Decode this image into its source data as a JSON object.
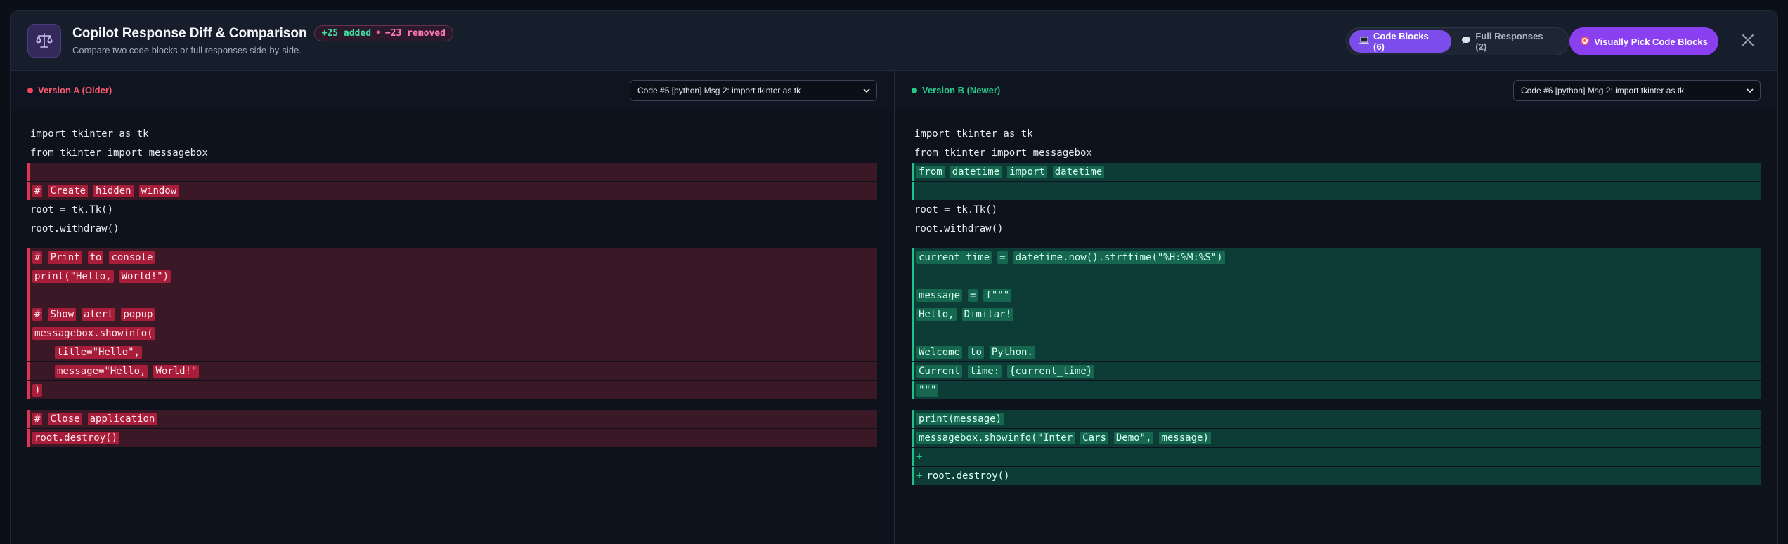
{
  "header": {
    "title": "Copilot Response Diff & Comparison",
    "stats": {
      "added": "+25 added",
      "sep": "•",
      "removed": "−23 removed"
    },
    "subtitle": "Compare two code blocks or full responses side-by-side.",
    "tabs": [
      {
        "label": "Code Blocks (6)",
        "icon": "laptop-icon",
        "active": true
      },
      {
        "label": "Full Responses (2)",
        "icon": "speech-bubble-icon",
        "active": false
      }
    ],
    "pick_button": {
      "label": "Visually Pick Code Blocks",
      "icon": "target-icon"
    },
    "close_icon": "close-icon"
  },
  "colors": {
    "accent": "#7c4dea",
    "removed": "#e0344f",
    "added": "#1fc28a"
  },
  "left": {
    "label": "Version A (Older)",
    "selected": "Code #5 [python] Msg 2: import tkinter as tk",
    "lines": [
      {
        "t": "plain",
        "text": "import tkinter as tk"
      },
      {
        "t": "plain",
        "text": "from tkinter import messagebox"
      },
      {
        "t": "removed",
        "toks": []
      },
      {
        "t": "removed",
        "toks": [
          "#",
          "Create",
          "hidden",
          "window"
        ]
      },
      {
        "t": "plain",
        "text": "root = tk.Tk()"
      },
      {
        "t": "plain",
        "text": "root.withdraw()"
      },
      {
        "t": "gap"
      },
      {
        "t": "removed",
        "toks": [
          "#",
          "Print",
          "to",
          "console"
        ]
      },
      {
        "t": "removed",
        "toks": [
          "print(\"Hello,",
          "World!\")"
        ]
      },
      {
        "t": "removed",
        "toks": []
      },
      {
        "t": "removed",
        "toks": [
          "#",
          "Show",
          "alert",
          "popup"
        ]
      },
      {
        "t": "removed",
        "toks": [
          "messagebox.showinfo("
        ]
      },
      {
        "t": "removed",
        "indent": true,
        "toks": [
          "title=\"Hello\","
        ]
      },
      {
        "t": "removed",
        "indent": true,
        "toks": [
          "message=\"Hello,",
          "World!\""
        ]
      },
      {
        "t": "removed",
        "toks": [
          ")"
        ]
      },
      {
        "t": "gap"
      },
      {
        "t": "removed",
        "toks": [
          "#",
          "Close",
          "application"
        ]
      },
      {
        "t": "removed",
        "toks": [
          "root.destroy()"
        ]
      }
    ]
  },
  "right": {
    "label": "Version B (Newer)",
    "selected": "Code #6 [python] Msg 2: import tkinter as tk",
    "lines": [
      {
        "t": "plain",
        "text": "import tkinter as tk"
      },
      {
        "t": "plain",
        "text": "from tkinter import messagebox"
      },
      {
        "t": "added",
        "toks": [
          "from",
          "datetime",
          "import",
          "datetime"
        ]
      },
      {
        "t": "added",
        "toks": []
      },
      {
        "t": "plain",
        "text": "root = tk.Tk()"
      },
      {
        "t": "plain",
        "text": "root.withdraw()"
      },
      {
        "t": "gap"
      },
      {
        "t": "added",
        "toks": [
          "current_time",
          "=",
          "datetime.now().strftime(\"%H:%M:%S\")"
        ]
      },
      {
        "t": "added",
        "toks": []
      },
      {
        "t": "added",
        "toks": [
          "message",
          "=",
          "f\"\"\""
        ]
      },
      {
        "t": "added",
        "toks": [
          "Hello,",
          "Dimitar!"
        ]
      },
      {
        "t": "added",
        "toks": []
      },
      {
        "t": "added",
        "toks": [
          "Welcome",
          "to",
          "Python."
        ]
      },
      {
        "t": "added",
        "toks": [
          "Current",
          "time:",
          "{current_time}"
        ]
      },
      {
        "t": "added",
        "toks": [
          "\"\"\""
        ]
      },
      {
        "t": "gap"
      },
      {
        "t": "added",
        "toks": [
          "print(message)"
        ]
      },
      {
        "t": "added",
        "toks": [
          "messagebox.showinfo(\"Inter",
          "Cars",
          "Demo\",",
          "message)"
        ]
      },
      {
        "t": "added",
        "prefix": "+",
        "toks": []
      },
      {
        "t": "added",
        "prefix": "+",
        "plain": "root.destroy()"
      }
    ]
  }
}
